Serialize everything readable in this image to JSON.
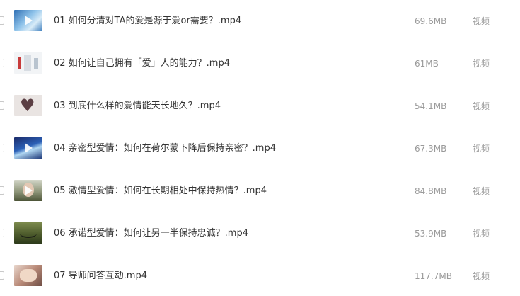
{
  "files": [
    {
      "name": "01 如何分清对TA的爱是源于爱or需要？.mp4",
      "size": "69.6MB",
      "type": "视频",
      "thumbnail": "video-thumbnail"
    },
    {
      "name": "02 如何让自己拥有「爱」人的能力？.mp4",
      "size": "61MB",
      "type": "视频",
      "thumbnail": "video-thumbnail"
    },
    {
      "name": "03 到底什么样的爱情能天长地久？.mp4",
      "size": "54.1MB",
      "type": "视频",
      "thumbnail": "video-thumbnail"
    },
    {
      "name": "04 亲密型爱情：如何在荷尔蒙下降后保持亲密？.mp4",
      "size": "67.3MB",
      "type": "视频",
      "thumbnail": "video-thumbnail"
    },
    {
      "name": "05 激情型爱情：如何在长期相处中保持热情？.mp4",
      "size": "84.8MB",
      "type": "视频",
      "thumbnail": "video-thumbnail"
    },
    {
      "name": "06 承诺型爱情：如何让另一半保持忠诚？.mp4",
      "size": "53.9MB",
      "type": "视频",
      "thumbnail": "video-thumbnail"
    },
    {
      "name": "07 导师问答互动.mp4",
      "size": "117.7MB",
      "type": "视频",
      "thumbnail": "video-thumbnail"
    }
  ],
  "colors": {
    "text_primary": "#333333",
    "text_secondary": "#9a9a9a",
    "checkbox_border": "#c9c9c9",
    "background": "#ffffff"
  }
}
